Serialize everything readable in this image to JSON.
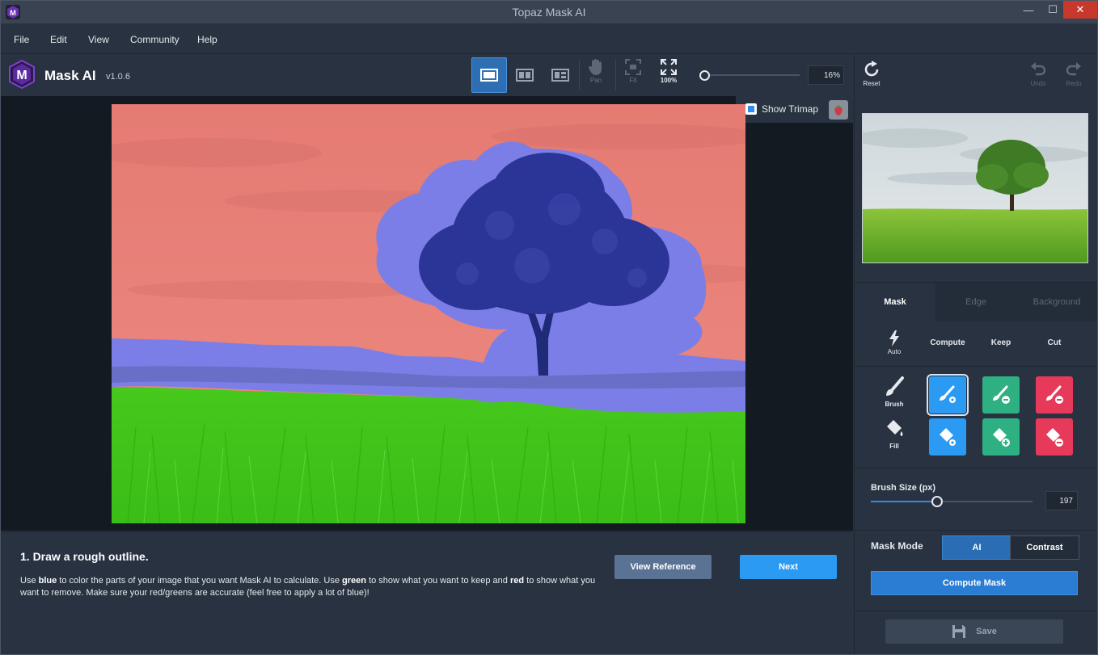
{
  "window": {
    "title": "Topaz Mask AI",
    "minimize_glyph": "—",
    "maximize_glyph": "☐",
    "close_glyph": "✕"
  },
  "menu": {
    "items": [
      {
        "label": "File"
      },
      {
        "label": "Edit"
      },
      {
        "label": "View"
      },
      {
        "label": "Community"
      },
      {
        "label": "Help"
      }
    ]
  },
  "app": {
    "name": "Mask AI",
    "version": "v1.0.6",
    "logo_letter": "M",
    "accent": "#2b9af3"
  },
  "toolbar": {
    "pan_label": "Pan",
    "fit_label": "Fit",
    "hundred_label": "100%",
    "zoom_value": "16%",
    "zoom_fraction": 0.0
  },
  "canvas": {
    "show_trimap_label": "Show Trimap",
    "colors": {
      "cut": "#e87b73",
      "compute": "#7b7ee6",
      "keep": "#43cc1e"
    }
  },
  "instructions": {
    "heading": "1. Draw a rough outline.",
    "p1": "Use ",
    "w_blue": "blue",
    "p2": " to color the parts of your image that you want Mask AI to calculate. Use ",
    "w_green": "green",
    "p3": " to show what you want to keep and ",
    "w_red": "red",
    "p4": " to show what you want to remove. Make sure your red/greens are accurate (feel free to apply a lot of blue)!",
    "view_reference_label": "View Reference",
    "next_label": "Next"
  },
  "right_panel": {
    "reset_label": "Reset",
    "undo_label": "Undo",
    "redo_label": "Redo",
    "tabs": [
      {
        "label": "Mask",
        "active": true
      },
      {
        "label": "Edge",
        "active": false
      },
      {
        "label": "Background",
        "active": false
      }
    ],
    "auto_label": "Auto",
    "columns": [
      "Compute",
      "Keep",
      "Cut"
    ],
    "brush_label": "Brush",
    "fill_label": "Fill",
    "brush_size_label": "Brush Size (px)",
    "brush_size_value": "197",
    "brush_size_fraction": 0.41,
    "mask_mode_label": "Mask Mode",
    "mask_mode_options": [
      "AI",
      "Contrast"
    ],
    "mask_mode_selected": "AI",
    "compute_mask_label": "Compute Mask",
    "save_label": "Save"
  }
}
